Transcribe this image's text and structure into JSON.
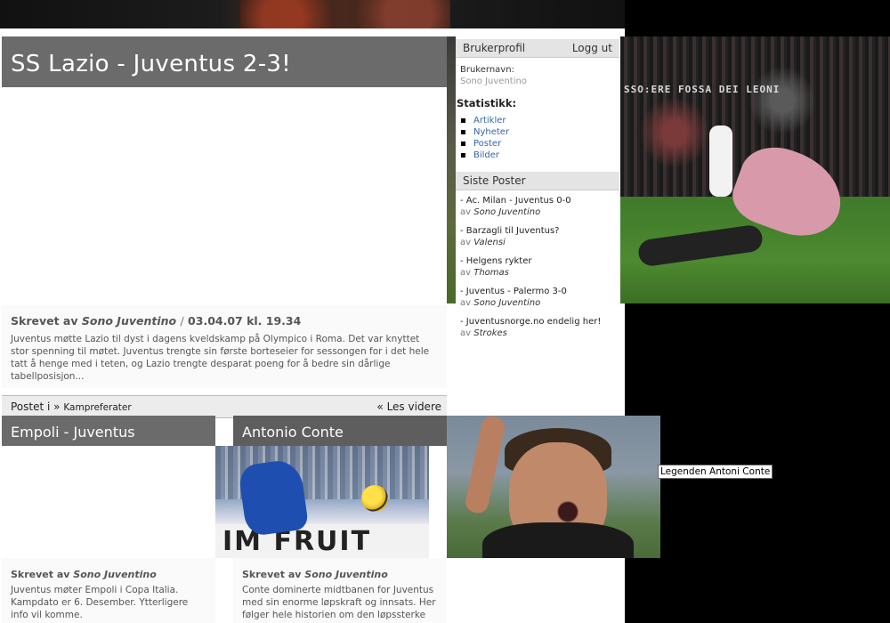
{
  "article1": {
    "title": "SS Lazio - Juventus 2-3!",
    "byline_prefix": "Skrevet av",
    "author": "Sono Juventino",
    "separator": "/",
    "date": "03.04.07 kl. 19.34",
    "excerpt": "Juventus møtte Lazio til dyst i dagens kveldskamp på Olympico i Roma. Det var knyttet stor spenning til møtet. Juventus trengte sin første borteseier for sessongen for i det hele tatt å henge med i teten, og Lazio trengte desparat poeng for å bedre sin dårlige tabellposisjon...",
    "posted_in": "Postet i »",
    "category": "Kampreferater",
    "read_more": "« Les videre"
  },
  "sidebar": {
    "profile_heading": "Brukerprofil",
    "logout": "Logg ut",
    "username_label": "Brukernavn:",
    "username": "Sono Juventino",
    "stats_heading": "Statistikk:",
    "stats": [
      "Artikler",
      "Nyheter",
      "Poster",
      "Bilder"
    ],
    "recent_heading": "Siste Poster",
    "by_label": "av",
    "recent_posts": [
      {
        "title": "- Ac. Milan - Juventus 0-0",
        "author": "Sono Juventino"
      },
      {
        "title": "- Barzagli til Juventus?",
        "author": "Valensi"
      },
      {
        "title": "- Helgens rykter",
        "author": "Thomas"
      },
      {
        "title": "- Juventus - Palermo 3-0",
        "author": "Sono Juventino"
      },
      {
        "title": "- Juventusnorge.no endelig her!",
        "author": "Strokes"
      }
    ]
  },
  "photo1": {
    "banner_text": "SSO:ERE  FOSSA  DEI LEONI"
  },
  "article2": {
    "title": "Empoli - Juventus",
    "byline_prefix": "Skrevet av",
    "author": "Sono Juventino",
    "excerpt": "Juventus møter Empoli i Copa Italia. Kampdato er 6. Desember. Ytterligere info vil komme."
  },
  "photo2": {
    "board_text": "IM  FRUIT"
  },
  "article3": {
    "title": "Antonio Conte",
    "byline_prefix": "Skrevet av",
    "author": "Sono Juventino",
    "excerpt": "Conte dominerte midtbanen for Juventus med sin enorme løpskraft og innsats. Her følger hele historien om den løpssterke Italieneren."
  },
  "tooltip": "Legenden Antoni Conte"
}
